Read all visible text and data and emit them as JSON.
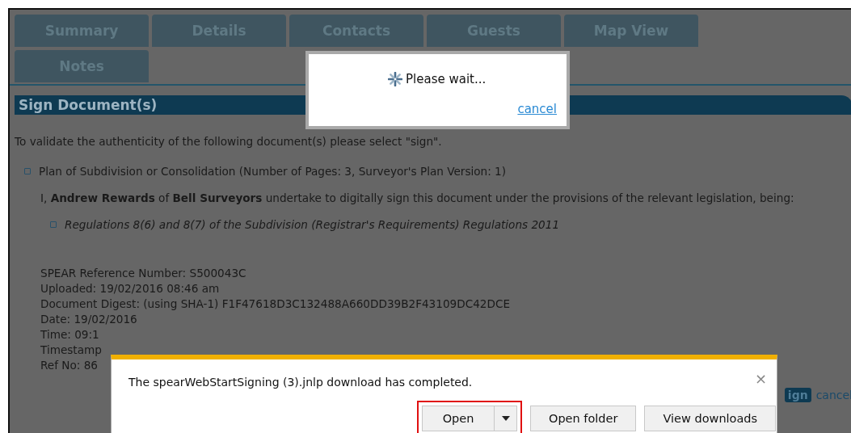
{
  "tabs": [
    {
      "label": "Summary"
    },
    {
      "label": "Details"
    },
    {
      "label": "Contacts"
    },
    {
      "label": "Guests"
    },
    {
      "label": "Map View"
    },
    {
      "label": "Notes"
    }
  ],
  "section": {
    "title": "Sign Document(s)",
    "intro": "To validate the authenticity of the following document(s) please select \"sign\".",
    "documents": [
      {
        "text": "Plan of Subdivision or Consolidation (Number of Pages: 3, Surveyor's Plan Version: 1)"
      }
    ],
    "declaration": "I, **Andrew Rewards** of **Bell Surveyors** undertake to digitally sign this document under the provisions of the relevant legislation, being:",
    "regulations": [
      {
        "text": "Regulations 8(6) and 8(7) of the Subdivision (Registrar's Requirements) Regulations 2011"
      }
    ],
    "details": [
      "SPEAR Reference Number: S500043C",
      "Uploaded: 19/02/2016 08:46 am",
      "Document Digest: (using SHA-1) F1F47618D3C132488A660DD39B2F43109DC42DCE",
      "Date: 19/02/2016",
      "Time: 09:1",
      "Timestamp",
      "Ref No: 86"
    ],
    "sign_button": "ign",
    "cancel_link": "cancel"
  },
  "wait_dialog": {
    "message": "Please wait...",
    "cancel": "cancel"
  },
  "download_bar": {
    "message": "The spearWebStartSigning (3).jnlp download has completed.",
    "close": "×",
    "buttons": [
      {
        "label": "Open",
        "kind": "split",
        "highlighted": true
      },
      {
        "label": "Open folder",
        "kind": "plain",
        "highlighted": false
      },
      {
        "label": "View downloads",
        "kind": "plain",
        "highlighted": false
      }
    ]
  }
}
